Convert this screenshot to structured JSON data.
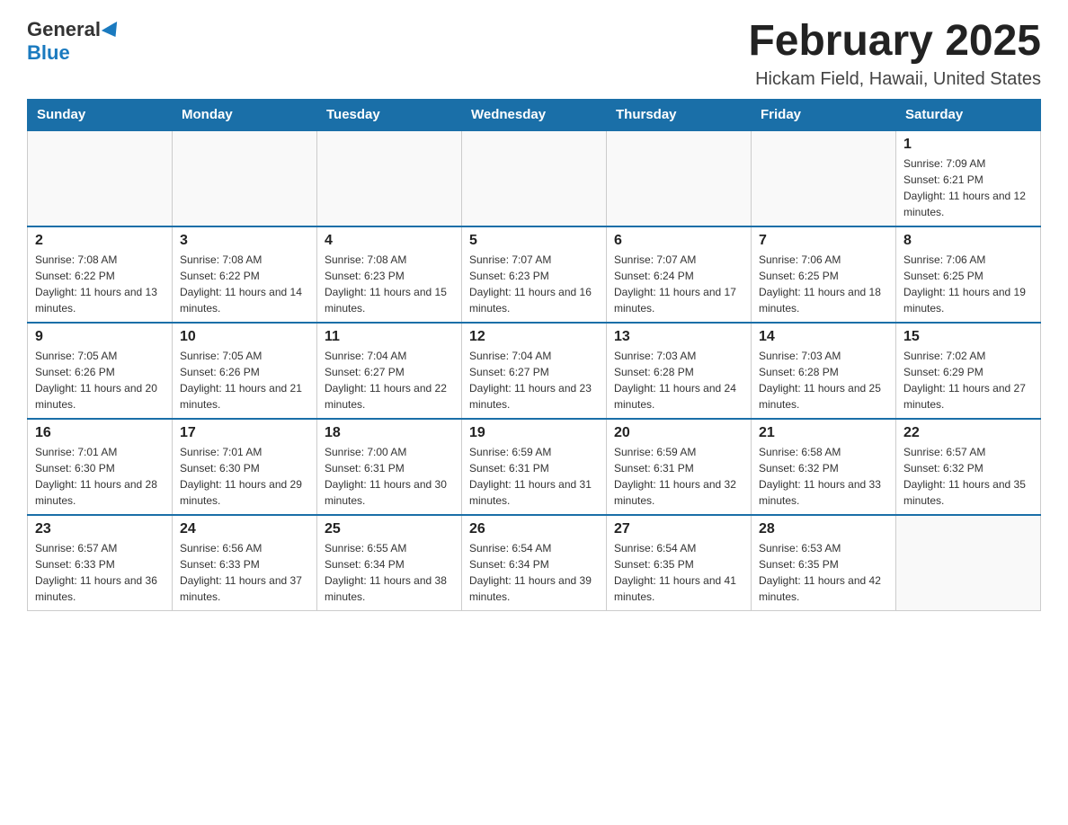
{
  "logo": {
    "general": "General",
    "blue": "Blue"
  },
  "header": {
    "title": "February 2025",
    "location": "Hickam Field, Hawaii, United States"
  },
  "weekdays": [
    "Sunday",
    "Monday",
    "Tuesday",
    "Wednesday",
    "Thursday",
    "Friday",
    "Saturday"
  ],
  "weeks": [
    [
      {
        "day": "",
        "info": ""
      },
      {
        "day": "",
        "info": ""
      },
      {
        "day": "",
        "info": ""
      },
      {
        "day": "",
        "info": ""
      },
      {
        "day": "",
        "info": ""
      },
      {
        "day": "",
        "info": ""
      },
      {
        "day": "1",
        "info": "Sunrise: 7:09 AM\nSunset: 6:21 PM\nDaylight: 11 hours and 12 minutes."
      }
    ],
    [
      {
        "day": "2",
        "info": "Sunrise: 7:08 AM\nSunset: 6:22 PM\nDaylight: 11 hours and 13 minutes."
      },
      {
        "day": "3",
        "info": "Sunrise: 7:08 AM\nSunset: 6:22 PM\nDaylight: 11 hours and 14 minutes."
      },
      {
        "day": "4",
        "info": "Sunrise: 7:08 AM\nSunset: 6:23 PM\nDaylight: 11 hours and 15 minutes."
      },
      {
        "day": "5",
        "info": "Sunrise: 7:07 AM\nSunset: 6:23 PM\nDaylight: 11 hours and 16 minutes."
      },
      {
        "day": "6",
        "info": "Sunrise: 7:07 AM\nSunset: 6:24 PM\nDaylight: 11 hours and 17 minutes."
      },
      {
        "day": "7",
        "info": "Sunrise: 7:06 AM\nSunset: 6:25 PM\nDaylight: 11 hours and 18 minutes."
      },
      {
        "day": "8",
        "info": "Sunrise: 7:06 AM\nSunset: 6:25 PM\nDaylight: 11 hours and 19 minutes."
      }
    ],
    [
      {
        "day": "9",
        "info": "Sunrise: 7:05 AM\nSunset: 6:26 PM\nDaylight: 11 hours and 20 minutes."
      },
      {
        "day": "10",
        "info": "Sunrise: 7:05 AM\nSunset: 6:26 PM\nDaylight: 11 hours and 21 minutes."
      },
      {
        "day": "11",
        "info": "Sunrise: 7:04 AM\nSunset: 6:27 PM\nDaylight: 11 hours and 22 minutes."
      },
      {
        "day": "12",
        "info": "Sunrise: 7:04 AM\nSunset: 6:27 PM\nDaylight: 11 hours and 23 minutes."
      },
      {
        "day": "13",
        "info": "Sunrise: 7:03 AM\nSunset: 6:28 PM\nDaylight: 11 hours and 24 minutes."
      },
      {
        "day": "14",
        "info": "Sunrise: 7:03 AM\nSunset: 6:28 PM\nDaylight: 11 hours and 25 minutes."
      },
      {
        "day": "15",
        "info": "Sunrise: 7:02 AM\nSunset: 6:29 PM\nDaylight: 11 hours and 27 minutes."
      }
    ],
    [
      {
        "day": "16",
        "info": "Sunrise: 7:01 AM\nSunset: 6:30 PM\nDaylight: 11 hours and 28 minutes."
      },
      {
        "day": "17",
        "info": "Sunrise: 7:01 AM\nSunset: 6:30 PM\nDaylight: 11 hours and 29 minutes."
      },
      {
        "day": "18",
        "info": "Sunrise: 7:00 AM\nSunset: 6:31 PM\nDaylight: 11 hours and 30 minutes."
      },
      {
        "day": "19",
        "info": "Sunrise: 6:59 AM\nSunset: 6:31 PM\nDaylight: 11 hours and 31 minutes."
      },
      {
        "day": "20",
        "info": "Sunrise: 6:59 AM\nSunset: 6:31 PM\nDaylight: 11 hours and 32 minutes."
      },
      {
        "day": "21",
        "info": "Sunrise: 6:58 AM\nSunset: 6:32 PM\nDaylight: 11 hours and 33 minutes."
      },
      {
        "day": "22",
        "info": "Sunrise: 6:57 AM\nSunset: 6:32 PM\nDaylight: 11 hours and 35 minutes."
      }
    ],
    [
      {
        "day": "23",
        "info": "Sunrise: 6:57 AM\nSunset: 6:33 PM\nDaylight: 11 hours and 36 minutes."
      },
      {
        "day": "24",
        "info": "Sunrise: 6:56 AM\nSunset: 6:33 PM\nDaylight: 11 hours and 37 minutes."
      },
      {
        "day": "25",
        "info": "Sunrise: 6:55 AM\nSunset: 6:34 PM\nDaylight: 11 hours and 38 minutes."
      },
      {
        "day": "26",
        "info": "Sunrise: 6:54 AM\nSunset: 6:34 PM\nDaylight: 11 hours and 39 minutes."
      },
      {
        "day": "27",
        "info": "Sunrise: 6:54 AM\nSunset: 6:35 PM\nDaylight: 11 hours and 41 minutes."
      },
      {
        "day": "28",
        "info": "Sunrise: 6:53 AM\nSunset: 6:35 PM\nDaylight: 11 hours and 42 minutes."
      },
      {
        "day": "",
        "info": ""
      }
    ]
  ]
}
